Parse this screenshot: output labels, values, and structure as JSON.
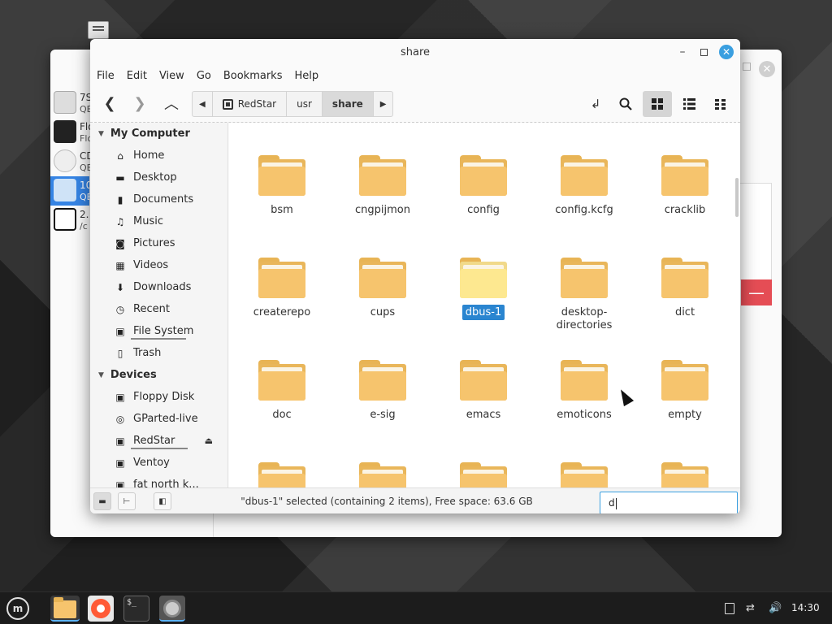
{
  "background_window": {
    "devices": [
      {
        "line1": "7S",
        "line2": "QE"
      },
      {
        "line1": "Flo",
        "line2": "Flo"
      },
      {
        "line1": "CD",
        "line2": "QE"
      },
      {
        "line1": "10",
        "line2": "QE"
      },
      {
        "line1": "2.",
        "line2": "/c"
      }
    ],
    "remove_label": "—"
  },
  "window": {
    "title": "share"
  },
  "menubar": [
    "File",
    "Edit",
    "View",
    "Go",
    "Bookmarks",
    "Help"
  ],
  "pathbar": {
    "left_arrow": "◀",
    "segments": [
      "RedStar",
      "usr",
      "share"
    ],
    "right_arrow": "▶"
  },
  "sidebar": {
    "sections": [
      {
        "title": "My Computer",
        "items": [
          {
            "label": "Home",
            "icon": "home-icon"
          },
          {
            "label": "Desktop",
            "icon": "desktop-icon"
          },
          {
            "label": "Documents",
            "icon": "documents-icon"
          },
          {
            "label": "Music",
            "icon": "music-icon"
          },
          {
            "label": "Pictures",
            "icon": "pictures-icon"
          },
          {
            "label": "Videos",
            "icon": "videos-icon"
          },
          {
            "label": "Downloads",
            "icon": "downloads-icon"
          },
          {
            "label": "Recent",
            "icon": "recent-icon"
          },
          {
            "label": "File System",
            "icon": "drive-icon"
          },
          {
            "label": "Trash",
            "icon": "trash-icon"
          }
        ]
      },
      {
        "title": "Devices",
        "items": [
          {
            "label": "Floppy Disk",
            "icon": "floppy-icon"
          },
          {
            "label": "GParted-live",
            "icon": "disc-icon"
          },
          {
            "label": "RedStar",
            "icon": "drive-icon"
          },
          {
            "label": "Ventoy",
            "icon": "drive-icon"
          },
          {
            "label": "fat north k...",
            "icon": "drive-icon"
          }
        ]
      }
    ]
  },
  "files": [
    {
      "name": "bsm"
    },
    {
      "name": "cngpijmon"
    },
    {
      "name": "config"
    },
    {
      "name": "config.kcfg"
    },
    {
      "name": "cracklib"
    },
    {
      "name": "createrepo"
    },
    {
      "name": "cups"
    },
    {
      "name": "dbus-1",
      "selected": true
    },
    {
      "name": "desktop-directories"
    },
    {
      "name": "dict"
    },
    {
      "name": "doc"
    },
    {
      "name": "e-sig"
    },
    {
      "name": "emacs"
    },
    {
      "name": "emoticons"
    },
    {
      "name": "empty"
    },
    {
      "name": ""
    },
    {
      "name": ""
    },
    {
      "name": ""
    },
    {
      "name": ""
    },
    {
      "name": ""
    }
  ],
  "status": {
    "text": "\"dbus-1\" selected (containing 2 items), Free space: 63.6 GB",
    "search_value": "d"
  },
  "taskbar": {
    "clock": "14:30",
    "terminal_glyph": "$_"
  },
  "colors": {
    "accent": "#3a9fe0",
    "folder": "#f6c46d",
    "selection": "#2a85d0"
  }
}
